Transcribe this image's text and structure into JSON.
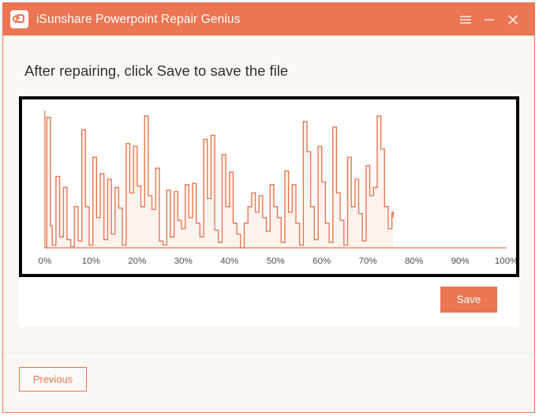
{
  "window": {
    "accent_color": "#ec7553",
    "border_color": "#e8734a",
    "background_color": "#fdf7f4"
  },
  "titlebar": {
    "app_title": "iSunshare Powerpoint Repair Genius",
    "logo_icon": "refresh-arrow-icon",
    "controls": [
      {
        "name": "menu-button",
        "icon": "hamburger-menu-icon"
      },
      {
        "name": "minimize-button",
        "icon": "minimize-icon"
      },
      {
        "name": "close-button",
        "icon": "close-icon"
      }
    ]
  },
  "main": {
    "heading": "After repairing, click Save to save the file",
    "save_label": "Save"
  },
  "footer": {
    "previous_label": "Previous"
  },
  "chart_data": {
    "type": "area",
    "title": "",
    "xlabel": "",
    "ylabel": "",
    "line_color": "#e8724c",
    "fill_color": "#fdf3ee",
    "axis_color": "#e8724c",
    "grid": false,
    "legend": null,
    "xlim": [
      0,
      100
    ],
    "ylim": [
      0,
      100
    ],
    "tick_labels": [
      "0%",
      "10%",
      "20%",
      "30%",
      "40%",
      "50%",
      "60%",
      "70%",
      "80%",
      "90%",
      "100%"
    ],
    "tick_values": [
      0,
      10,
      20,
      30,
      40,
      50,
      60,
      70,
      80,
      90,
      100
    ],
    "data_end_x": 75.5,
    "x": [
      0,
      0.4,
      0.8,
      1.2,
      1.6,
      2.0,
      2.4,
      2.8,
      3.2,
      3.6,
      4.0,
      4.4,
      4.8,
      5.2,
      5.6,
      6.0,
      6.4,
      6.8,
      7.2,
      7.6,
      8.0,
      8.4,
      8.8,
      9.2,
      9.6,
      10.0,
      10.4,
      10.8,
      11.2,
      11.6,
      12.0,
      12.4,
      12.8,
      13.2,
      13.6,
      14.0,
      14.4,
      14.8,
      15.2,
      15.6,
      16.0,
      16.4,
      16.8,
      17.2,
      17.6,
      18.0,
      18.4,
      18.8,
      19.2,
      19.6,
      20.0,
      20.4,
      20.8,
      21.2,
      21.6,
      22.0,
      22.4,
      22.8,
      23.2,
      23.6,
      24.0,
      24.4,
      24.8,
      25.2,
      25.6,
      26.0,
      26.4,
      26.8,
      27.2,
      27.6,
      28.0,
      28.4,
      28.8,
      29.2,
      29.6,
      30.0,
      30.4,
      30.8,
      31.2,
      31.6,
      32.0,
      32.4,
      32.8,
      33.2,
      33.6,
      34.0,
      34.4,
      34.8,
      35.2,
      35.6,
      36.0,
      36.4,
      36.8,
      37.2,
      37.6,
      38.0,
      38.4,
      38.8,
      39.2,
      39.6,
      40.0,
      40.4,
      40.8,
      41.2,
      41.6,
      42.0,
      42.4,
      42.8,
      43.2,
      43.6,
      44.0,
      44.4,
      44.8,
      45.2,
      45.6,
      46.0,
      46.4,
      46.8,
      47.2,
      47.6,
      48.0,
      48.4,
      48.8,
      49.2,
      49.6,
      50.0,
      50.4,
      50.8,
      51.2,
      51.6,
      52.0,
      52.4,
      52.8,
      53.2,
      53.6,
      54.0,
      54.4,
      54.8,
      55.2,
      55.6,
      56.0,
      56.4,
      56.8,
      57.2,
      57.6,
      58.0,
      58.4,
      58.8,
      59.2,
      59.6,
      60.0,
      60.4,
      60.8,
      61.2,
      61.6,
      62.0,
      62.4,
      62.8,
      63.2,
      63.6,
      64.0,
      64.4,
      64.8,
      65.2,
      65.6,
      66.0,
      66.4,
      66.8,
      67.2,
      67.6,
      68.0,
      68.4,
      68.8,
      69.2,
      69.6,
      70.0,
      70.4,
      70.8,
      71.2,
      71.6,
      72.0,
      72.4,
      72.8,
      73.2,
      73.6,
      74.0,
      74.4,
      74.8,
      75.2,
      75.5
    ],
    "values": [
      0,
      95,
      95,
      16,
      2,
      2,
      52,
      52,
      8,
      8,
      44,
      44,
      6,
      6,
      1,
      1,
      30,
      30,
      5,
      5,
      86,
      86,
      30,
      30,
      2,
      2,
      66,
      66,
      22,
      22,
      54,
      54,
      6,
      6,
      50,
      50,
      10,
      10,
      44,
      44,
      29,
      29,
      2,
      2,
      76,
      76,
      40,
      40,
      74,
      74,
      45,
      45,
      30,
      30,
      96,
      96,
      38,
      38,
      28,
      28,
      58,
      58,
      5,
      5,
      2,
      2,
      42,
      42,
      8,
      8,
      41,
      41,
      20,
      20,
      14,
      14,
      46,
      46,
      22,
      22,
      47,
      47,
      18,
      18,
      8,
      8,
      79,
      79,
      36,
      36,
      82,
      82,
      13,
      13,
      4,
      4,
      68,
      68,
      30,
      30,
      55,
      55,
      18,
      18,
      10,
      10,
      0,
      0,
      18,
      18,
      30,
      30,
      40,
      40,
      26,
      26,
      38,
      38,
      22,
      22,
      12,
      12,
      46,
      46,
      30,
      30,
      22,
      22,
      4,
      4,
      56,
      56,
      26,
      26,
      46,
      46,
      18,
      18,
      2,
      2,
      92,
      92,
      70,
      70,
      30,
      30,
      6,
      6,
      74,
      74,
      48,
      48,
      18,
      18,
      4,
      4,
      88,
      88,
      40,
      40,
      20,
      20,
      2,
      2,
      66,
      66,
      30,
      30,
      50,
      50,
      25,
      25,
      5,
      5,
      60,
      60,
      38,
      38,
      44,
      44,
      96,
      96,
      72,
      72,
      30,
      30,
      14,
      14,
      26,
      22
    ]
  }
}
